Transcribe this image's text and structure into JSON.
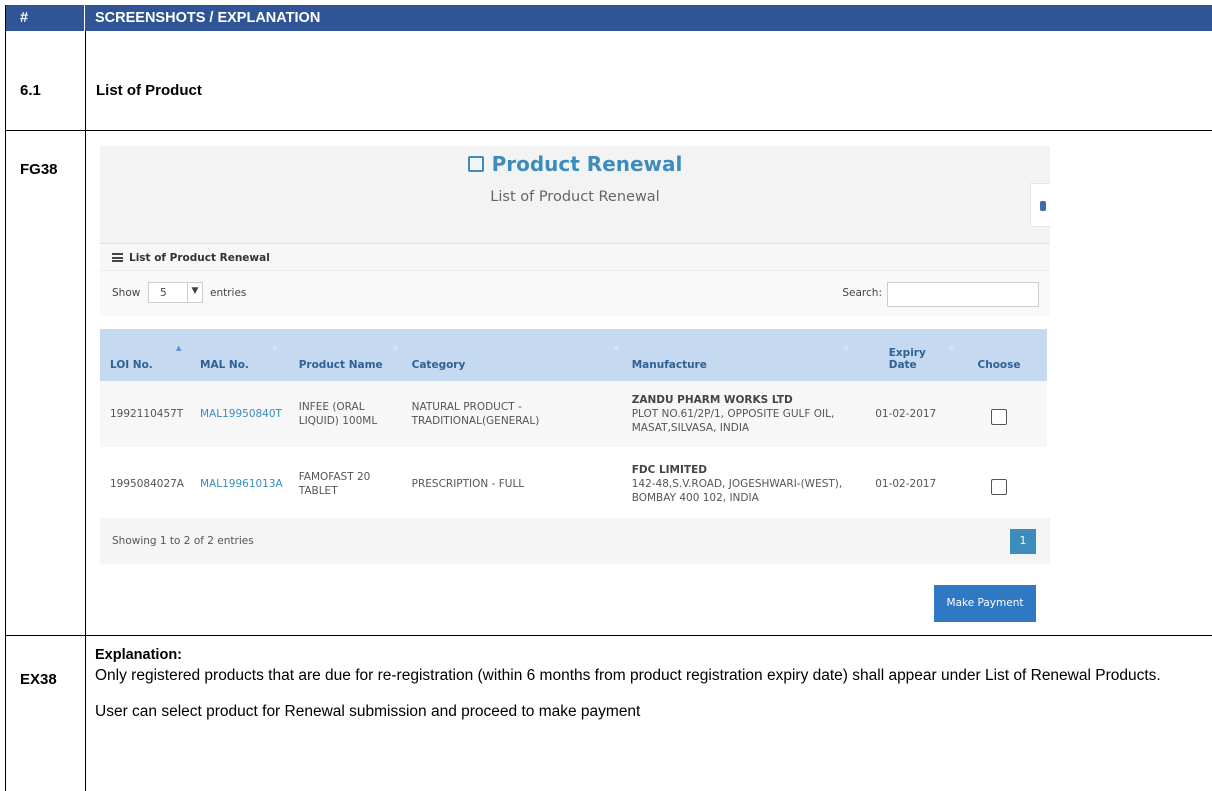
{
  "doc": {
    "header": {
      "num_col": "#",
      "text_col": "SCREENSHOTS / EXPLANATION"
    },
    "section": {
      "num": "6.1",
      "title": "List of Product"
    },
    "figure_id": "FG38",
    "explanation_id": "EX38",
    "explanation": {
      "heading": "Explanation:",
      "para1": "Only registered products that are due for re-registration (within 6 months from product registration expiry date) shall appear under List of Renewal Products.",
      "para2": "User can select product for Renewal submission and proceed to make payment"
    }
  },
  "screen": {
    "page_title": "Product Renewal",
    "page_subtitle": "List of Product Renewal",
    "box_title": "List of Product Renewal",
    "show_label": "Show",
    "entries_value": "5",
    "entries_label": "entries",
    "search_label": "Search:",
    "search_value": "",
    "columns": [
      "LOI No.",
      "MAL No.",
      "Product Name",
      "Category",
      "Manufacture",
      "Expiry Date",
      "Choose"
    ],
    "rows": [
      {
        "loi": "1992110457T",
        "mal": "MAL19950840T",
        "product": "INFEE (ORAL LIQUID) 100ML",
        "category": "NATURAL PRODUCT - TRADITIONAL(GENERAL)",
        "mfg_name": "ZANDU PHARM WORKS LTD",
        "mfg_addr": "PLOT NO.61/2P/1, OPPOSITE GULF OIL, MASAT,SILVASA, INDIA",
        "expiry": "01-02-2017",
        "checked": false
      },
      {
        "loi": "1995084027A",
        "mal": "MAL19961013A",
        "product": "FAMOFAST 20 TABLET",
        "category": "PRESCRIPTION - FULL",
        "mfg_name": "FDC LIMITED",
        "mfg_addr": "142-48,S.V.ROAD, JOGESHWARI-(WEST), BOMBAY 400 102, INDIA",
        "expiry": "01-02-2017",
        "checked": false
      }
    ],
    "showing_info": "Showing 1 to 2 of 2 entries",
    "current_page": "1",
    "pay_button": "Make Payment",
    "colors": {
      "header_bar": "#2f5597",
      "accent": "#3c8dbc",
      "table_head": "#c5d9f1",
      "button": "#2f78c4"
    }
  }
}
